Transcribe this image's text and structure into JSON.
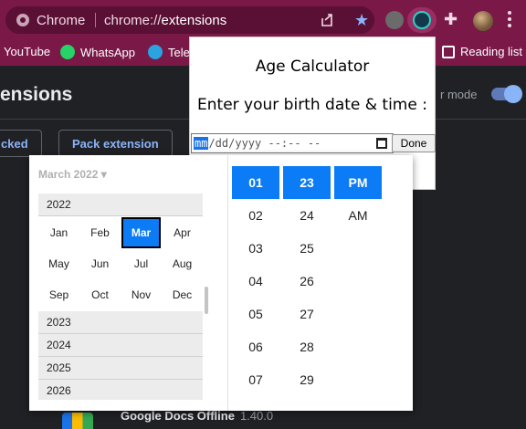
{
  "browser": {
    "omnibox_label": "Chrome",
    "url_prefix": "chrome://",
    "url_host": "extensions",
    "bookmarks": [
      "YouTube",
      "WhatsApp",
      "Tele",
      "Reading list"
    ]
  },
  "extensions_page": {
    "title": "ensions",
    "dev_mode_label": "r mode",
    "buttons": [
      "cked",
      "Pack extension"
    ],
    "extension_name": "Google Docs Offline",
    "extension_version": "1.40.0"
  },
  "popup": {
    "title": "Age Calculator",
    "prompt": "Enter your birth date & time :",
    "input": {
      "mm": "mm",
      "rest": "/dd/yyyy --:-- --"
    },
    "done_label": "Done"
  },
  "picker": {
    "month_select": "March 2022 ▾",
    "year_current": "2022",
    "months": [
      "Jan",
      "Feb",
      "Mar",
      "Apr",
      "May",
      "Jun",
      "Jul",
      "Aug",
      "Sep",
      "Oct",
      "Nov",
      "Dec"
    ],
    "selected_month": "Mar",
    "years_after": [
      "2023",
      "2024",
      "2025",
      "2026"
    ],
    "hours": [
      "01",
      "02",
      "03",
      "04",
      "05",
      "06",
      "07"
    ],
    "minutes": [
      "23",
      "24",
      "25",
      "26",
      "27",
      "28",
      "29"
    ],
    "meridiem": [
      "PM",
      "AM"
    ],
    "selected_hour": "01",
    "selected_minute": "23",
    "selected_meridiem": "PM"
  }
}
